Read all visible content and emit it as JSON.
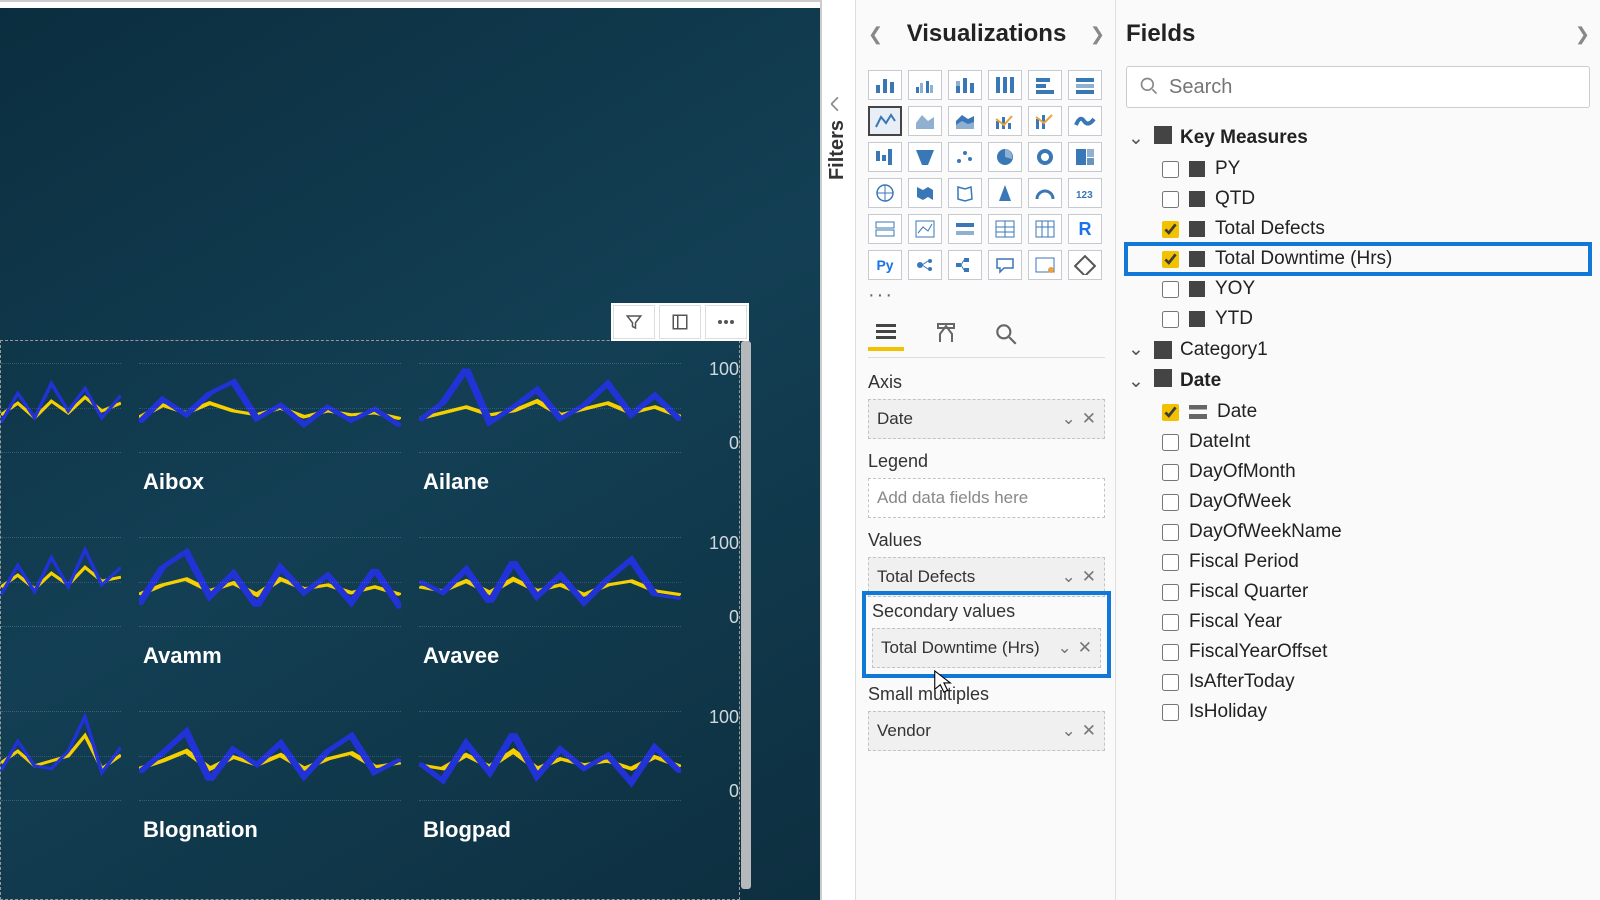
{
  "filters_tab": {
    "label": "Filters"
  },
  "viz": {
    "title": "Visualizations",
    "more": "···",
    "wells": {
      "axis_label": "Axis",
      "axis_value": "Date",
      "legend_label": "Legend",
      "legend_placeholder": "Add data fields here",
      "values_label": "Values",
      "values_value": "Total Defects",
      "secondary_label": "Secondary values",
      "secondary_value": "Total Downtime (Hrs)",
      "small_label": "Small multiples",
      "small_value": "Vendor"
    }
  },
  "fields": {
    "title": "Fields",
    "search_placeholder": "Search",
    "tables": {
      "key_measures": "Key Measures",
      "category1": "Category1",
      "date": "Date"
    },
    "key_measures_items": {
      "py": "PY",
      "qtd": "QTD",
      "total_defects": "Total Defects",
      "total_downtime": "Total Downtime (Hrs)",
      "yoy": "YOY",
      "ytd": "YTD"
    },
    "date_items": {
      "date": "Date",
      "dateint": "DateInt",
      "dayofmonth": "DayOfMonth",
      "dayofweek": "DayOfWeek",
      "dayofweekname": "DayOfWeekName",
      "fiscal_period": "Fiscal Period",
      "fiscal_quarter": "Fiscal Quarter",
      "fiscal_year": "Fiscal Year",
      "fy_offset": "FiscalYearOffset",
      "is_after_today": "IsAfterToday",
      "is_holiday": "IsHoliday"
    }
  },
  "canvas": {
    "tiles": {
      "aibox": "Aibox",
      "ailane": "Ailane",
      "avamm": "Avamm",
      "avavee": "Avavee",
      "blognation": "Blognation",
      "blogpad": "Blogpad"
    },
    "axis100": "100",
    "axis0": "0"
  },
  "chart_data": [
    {
      "type": "line",
      "title": "Aibox",
      "ylim": [
        0,
        100
      ],
      "x": [
        0,
        1,
        2,
        3,
        4,
        5,
        6,
        7,
        8,
        9,
        10,
        11
      ],
      "series": [
        {
          "name": "Total Defects",
          "color": "#2133d6",
          "values": [
            30,
            55,
            40,
            58,
            70,
            35,
            50,
            30,
            48,
            32,
            45,
            28
          ]
        },
        {
          "name": "Total Downtime (Hrs)",
          "color": "#f6cf00",
          "values": [
            28,
            50,
            42,
            55,
            48,
            38,
            45,
            33,
            40,
            36,
            38,
            30
          ]
        }
      ]
    },
    {
      "type": "line",
      "title": "Ailane",
      "ylim": [
        0,
        100
      ],
      "x": [
        0,
        1,
        2,
        3,
        4,
        5,
        6,
        7,
        8,
        9,
        10,
        11
      ],
      "series": [
        {
          "name": "Total Defects",
          "color": "#2133d6",
          "values": [
            32,
            52,
            92,
            30,
            48,
            66,
            35,
            50,
            72,
            40,
            60,
            34
          ]
        },
        {
          "name": "Total Downtime (Hrs)",
          "color": "#f6cf00",
          "values": [
            34,
            42,
            48,
            40,
            44,
            55,
            38,
            46,
            52,
            42,
            48,
            36
          ]
        }
      ]
    },
    {
      "type": "line",
      "title": "Avamm",
      "ylim": [
        0,
        100
      ],
      "x": [
        0,
        1,
        2,
        3,
        4,
        5,
        6,
        7,
        8,
        9,
        10,
        11
      ],
      "series": [
        {
          "name": "Total Defects",
          "color": "#2133d6",
          "values": [
            20,
            65,
            82,
            30,
            58,
            20,
            65,
            35,
            55,
            25,
            60,
            18
          ]
        },
        {
          "name": "Total Downtime (Hrs)",
          "color": "#f6cf00",
          "values": [
            28,
            45,
            50,
            36,
            48,
            30,
            50,
            38,
            44,
            32,
            42,
            28
          ]
        }
      ]
    },
    {
      "type": "line",
      "title": "Avavee",
      "ylim": [
        0,
        100
      ],
      "x": [
        0,
        1,
        2,
        3,
        4,
        5,
        6,
        7,
        8,
        9,
        10,
        11
      ],
      "series": [
        {
          "name": "Total Defects",
          "color": "#2133d6",
          "values": [
            48,
            35,
            62,
            25,
            68,
            32,
            55,
            26,
            50,
            70,
            34,
            30
          ]
        },
        {
          "name": "Total Downtime (Hrs)",
          "color": "#f6cf00",
          "values": [
            42,
            38,
            48,
            34,
            50,
            36,
            45,
            32,
            44,
            48,
            38,
            32
          ]
        }
      ]
    },
    {
      "type": "line",
      "title": "Blognation",
      "ylim": [
        0,
        100
      ],
      "x": [
        0,
        1,
        2,
        3,
        4,
        5,
        6,
        7,
        8,
        9,
        10,
        11
      ],
      "series": [
        {
          "name": "Total Defects",
          "color": "#2133d6",
          "values": [
            28,
            50,
            72,
            22,
            55,
            38,
            60,
            25,
            52,
            68,
            30,
            45
          ]
        },
        {
          "name": "Total Downtime (Hrs)",
          "color": "#f6cf00",
          "values": [
            30,
            42,
            52,
            30,
            46,
            36,
            48,
            32,
            44,
            50,
            34,
            38
          ]
        }
      ]
    },
    {
      "type": "line",
      "title": "Blogpad",
      "ylim": [
        0,
        100
      ],
      "x": [
        0,
        1,
        2,
        3,
        4,
        5,
        6,
        7,
        8,
        9,
        10,
        11
      ],
      "series": [
        {
          "name": "Total Defects",
          "color": "#2133d6",
          "values": [
            40,
            22,
            60,
            30,
            70,
            26,
            55,
            34,
            48,
            20,
            58,
            30
          ]
        },
        {
          "name": "Total Downtime (Hrs)",
          "color": "#f6cf00",
          "values": [
            36,
            30,
            48,
            34,
            52,
            32,
            44,
            36,
            42,
            30,
            46,
            34
          ]
        }
      ]
    }
  ]
}
